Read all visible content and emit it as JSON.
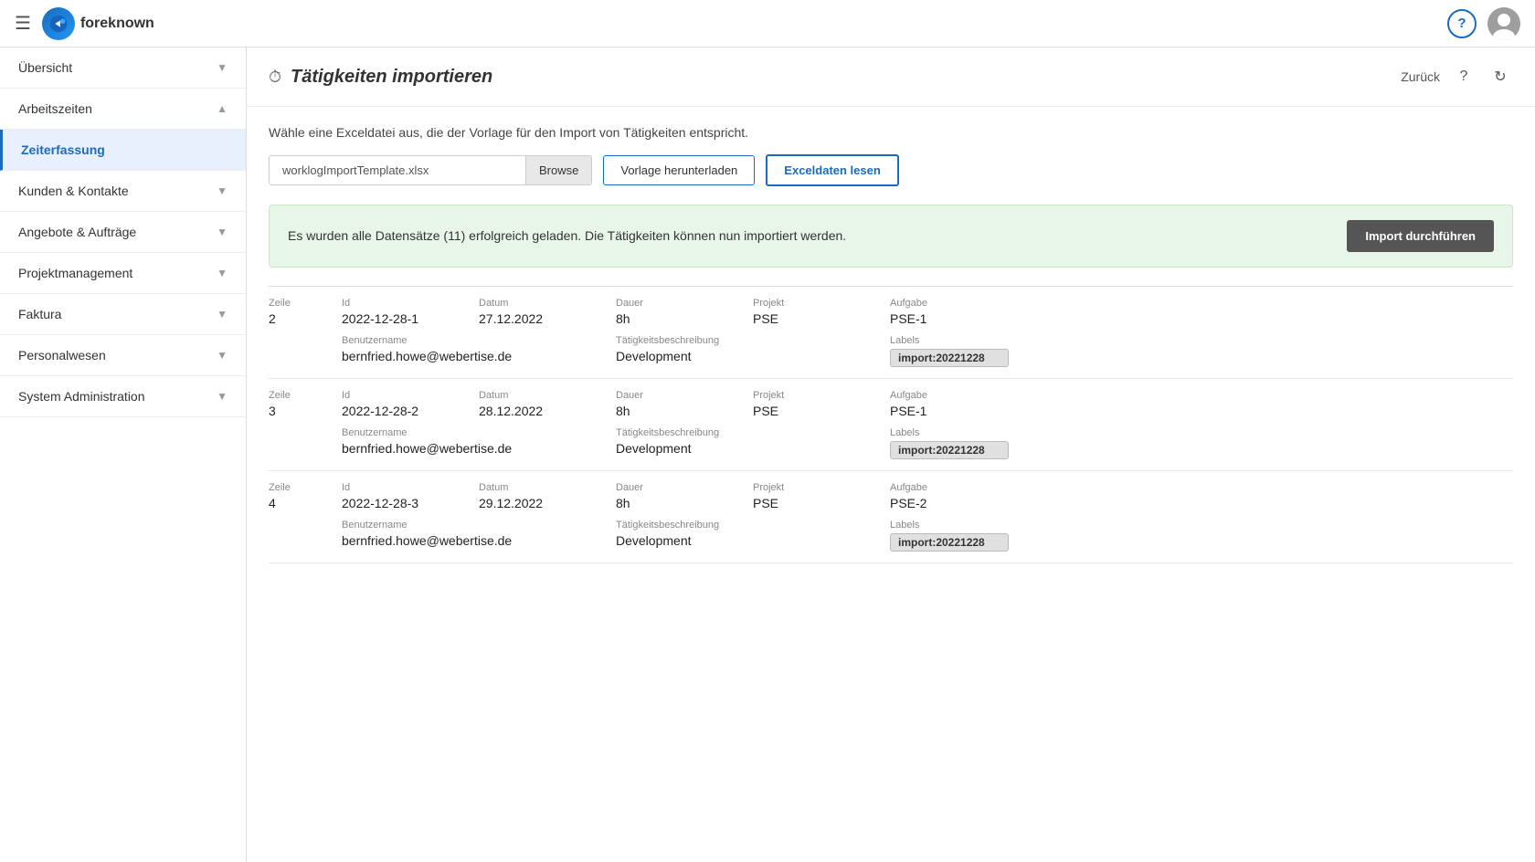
{
  "topBar": {
    "hamburger": "☰",
    "logoText": "foreknown",
    "helpLabel": "?",
    "avatarAlt": "User avatar"
  },
  "sidebar": {
    "items": [
      {
        "id": "ubersicht",
        "label": "Übersicht",
        "chevron": "down",
        "active": false
      },
      {
        "id": "arbeitszeiten",
        "label": "Arbeitszeiten",
        "chevron": "up",
        "active": false
      },
      {
        "id": "zeiterfassung",
        "label": "Zeiterfassung",
        "chevron": null,
        "active": true
      },
      {
        "id": "kunden",
        "label": "Kunden & Kontakte",
        "chevron": "down",
        "active": false
      },
      {
        "id": "angebote",
        "label": "Angebote & Aufträge",
        "chevron": "down",
        "active": false
      },
      {
        "id": "projektmanagement",
        "label": "Projektmanagement",
        "chevron": "down",
        "active": false
      },
      {
        "id": "faktura",
        "label": "Faktura",
        "chevron": "down",
        "active": false
      },
      {
        "id": "personalwesen",
        "label": "Personalwesen",
        "chevron": "down",
        "active": false
      },
      {
        "id": "sysadmin",
        "label": "System Administration",
        "chevron": "down",
        "active": false
      }
    ]
  },
  "page": {
    "icon": "⏱",
    "title": "Tätigkeiten importieren",
    "backLabel": "Zurück",
    "subtitle": "Wähle eine Exceldatei aus, die der Vorlage für den Import von Tätigkeiten entspricht.",
    "fileNameLabel": "worklogImportTemplate.xlsx",
    "browseBtnLabel": "Browse",
    "downloadBtnLabel": "Vorlage herunterladen",
    "readBtnLabel": "Exceldaten lesen",
    "successText": "Es wurden alle Datensätze (11) erfolgreich geladen. Die Tätigkeiten können nun importiert werden.",
    "importBtnLabel": "Import durchführen"
  },
  "columns": {
    "zeile": "Zeile",
    "id": "Id",
    "datum": "Datum",
    "dauer": "Dauer",
    "projekt": "Projekt",
    "aufgabe": "Aufgabe",
    "benutzername": "Benutzername",
    "taetigkeitsbeschreibung": "Tätigkeitsbeschreibung",
    "labels": "Labels"
  },
  "records": [
    {
      "zeile": "2",
      "id": "2022-12-28-1",
      "datum": "27.12.2022",
      "dauer": "8h",
      "projekt": "PSE",
      "aufgabe": "PSE-1",
      "benutzername": "bernfried.howe@webertise.de",
      "taetigkeitsbeschreibung": "Development",
      "labels": "import:20221228"
    },
    {
      "zeile": "3",
      "id": "2022-12-28-2",
      "datum": "28.12.2022",
      "dauer": "8h",
      "projekt": "PSE",
      "aufgabe": "PSE-1",
      "benutzername": "bernfried.howe@webertise.de",
      "taetigkeitsbeschreibung": "Development",
      "labels": "import:20221228"
    },
    {
      "zeile": "4",
      "id": "2022-12-28-3",
      "datum": "29.12.2022",
      "dauer": "8h",
      "projekt": "PSE",
      "aufgabe": "PSE-2",
      "benutzername": "bernfried.howe@webertise.de",
      "taetigkeitsbeschreibung": "Development",
      "labels": "import:20221228"
    }
  ]
}
